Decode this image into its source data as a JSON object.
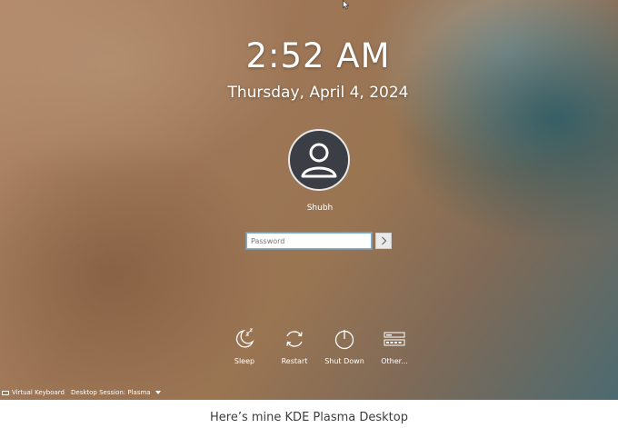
{
  "lockscreen": {
    "time": "2:52 AM",
    "date": "Thursday, April 4, 2024",
    "user": {
      "name": "Shubh",
      "avatar_icon": "user-avatar-icon"
    },
    "password": {
      "placeholder": "Password",
      "value": ""
    },
    "login_icon": "chevron-right-icon",
    "actions": [
      {
        "label": "Sleep",
        "icon": "sleep-moon-icon"
      },
      {
        "label": "Restart",
        "icon": "restart-icon"
      },
      {
        "label": "Shut Down",
        "icon": "power-icon"
      },
      {
        "label": "Other...",
        "icon": "other-sessions-icon"
      }
    ],
    "bottom_bar": {
      "virtual_keyboard": "Virtual Keyboard",
      "session": "Desktop Session: Plasma"
    }
  },
  "caption": "Here’s mine KDE Plasma Desktop"
}
